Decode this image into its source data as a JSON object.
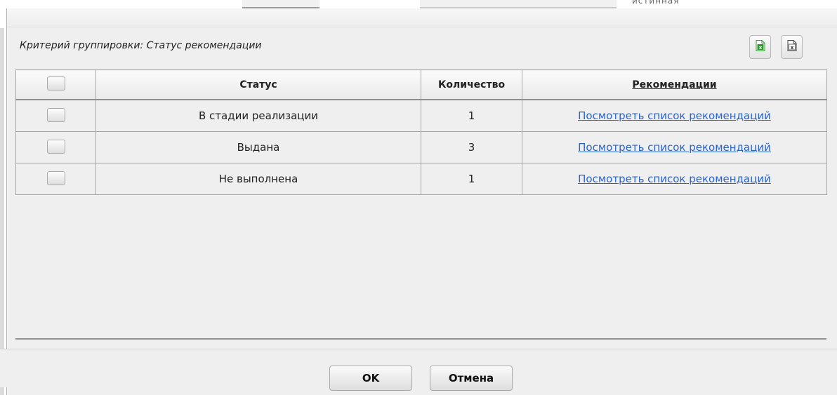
{
  "background": {
    "partial_text": "истинная"
  },
  "dialog": {
    "grouping_label": "Критерий группировки: Статус рекомендации",
    "export_buttons": [
      {
        "name": "excel-export",
        "icon": "excel-green-icon",
        "color": "#2e9a2e"
      },
      {
        "name": "excel-export-plain",
        "icon": "excel-gray-icon",
        "color": "#444444"
      }
    ],
    "table": {
      "columns": [
        "",
        "Статус",
        "Количество",
        "Рекомендации"
      ],
      "rows": [
        {
          "status": "В стадии реализации",
          "count": "1",
          "link": "Посмотреть список рекомендаций"
        },
        {
          "status": "Выдана",
          "count": "3",
          "link": "Посмотреть список рекомендаций"
        },
        {
          "status": "Не выполнена",
          "count": "1",
          "link": "Посмотреть список рекомендаций"
        }
      ]
    },
    "footer": {
      "ok_label": "OK",
      "cancel_label": "Отмена"
    }
  },
  "colors": {
    "link": "#2a64c9",
    "panel_bg": "#efefef",
    "border": "#a7a7a7"
  }
}
